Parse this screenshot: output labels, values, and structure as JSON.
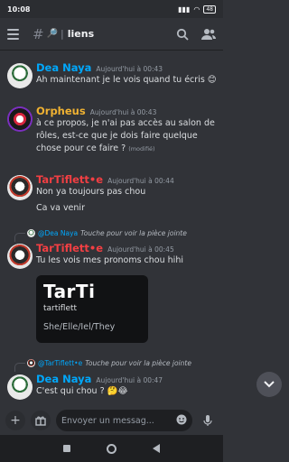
{
  "statusbar": {
    "time": "10:08",
    "battery": "48"
  },
  "header": {
    "channel_name": "liens",
    "channel_emoji": "🔎"
  },
  "messages": [
    {
      "author": "Dea Naya",
      "color": "#00a8fc",
      "timestamp": "Aujourd'hui à 00:43",
      "lines": [
        "Ah maintenant je le vois quand tu écris 😊"
      ]
    },
    {
      "author": "Orpheus",
      "color": "#f0b232",
      "timestamp": "Aujourd'hui à 00:43",
      "lines": [
        "à ce propos, je n'ai pas accès au salon de rôles, est-ce que je dois faire quelque chose pour ce faire ?"
      ],
      "edited": "(modifié)"
    },
    {
      "author": "TarTiflett•e",
      "color": "#f23f43",
      "timestamp": "Aujourd'hui à 00:44",
      "lines": [
        "Non ya toujours pas chou",
        "Ca va venir"
      ]
    },
    {
      "reply": {
        "name": "@Dea Naya",
        "text": "Touche pour voir la pièce jointe"
      },
      "author": "TarTiflett•e",
      "color": "#f23f43",
      "timestamp": "Aujourd'hui à 00:45",
      "lines": [
        "Tu les vois mes pronoms chou hihi"
      ]
    },
    {
      "reply": {
        "name": "@TarTiflett•e",
        "text": "Touche pour voir la pièce jointe"
      },
      "author": "Dea Naya",
      "color": "#00a8fc",
      "timestamp": "Aujourd'hui à 00:47",
      "lines": [
        "C'est qui chou ? 🤔😂"
      ]
    }
  ],
  "card": {
    "title": "TarTi",
    "username": "tartiflett",
    "pronouns": "She/Elle/Iel/They"
  },
  "composer": {
    "placeholder": "Envoyer un messag..."
  }
}
